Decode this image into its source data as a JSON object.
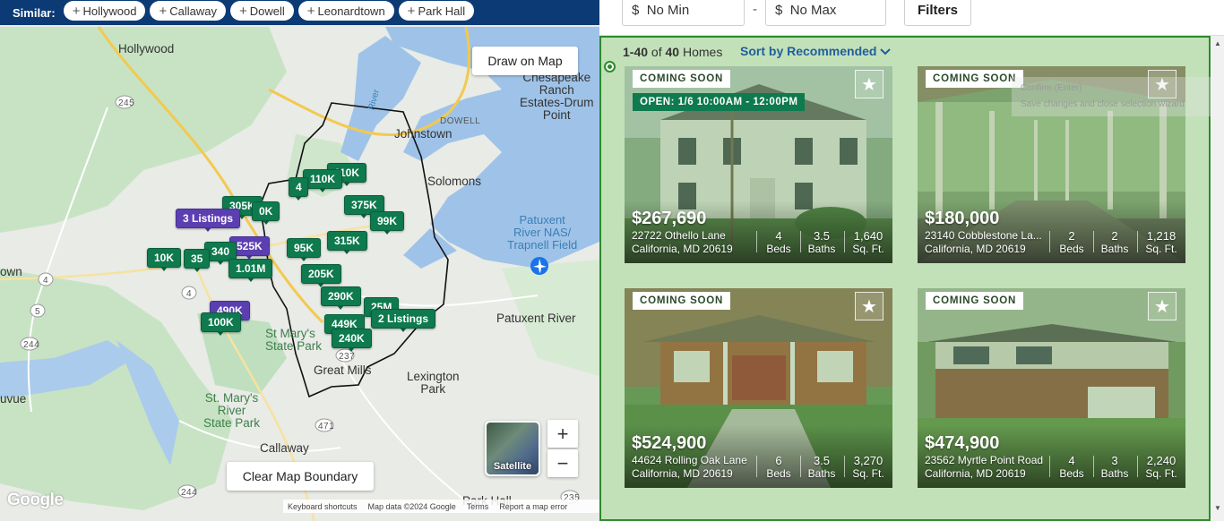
{
  "similar": {
    "label": "Similar:",
    "chips": [
      "Hollywood",
      "Callaway",
      "Dowell",
      "Leonardtown",
      "Park Hall"
    ]
  },
  "map": {
    "places": {
      "hollywood": "Hollywood",
      "chesapeake": "Chesapeake",
      "chesapeake2": "Ranch",
      "chesapeake3": "Estates-Drum",
      "chesapeake4": "Point",
      "dowell": "DOWELL",
      "johnstown": "Johnstown",
      "solomons": "Solomons",
      "patuxent1": "Patuxent",
      "patuxent2": "River NAS/",
      "patuxent3": "Trapnell Field",
      "patuxent_river": "Patuxent River",
      "stmarys_sp1": "St Mary's",
      "stmarys_sp2": "State Park",
      "great_mills": "Great Mills",
      "lexington1": "Lexington",
      "lexington2": "Park",
      "stmarys_river1": "St. Mary's",
      "stmarys_river2": "River",
      "stmarys_river3": "State Park",
      "callaway": "Callaway",
      "town": "own",
      "vue": "uvue",
      "park_hall": "Park Hall",
      "river": "River"
    },
    "routes": [
      "245",
      "4",
      "5",
      "4",
      "244",
      "237",
      "471",
      "244",
      "235"
    ],
    "pins": [
      {
        "label": "110K",
        "type": "g"
      },
      {
        "label": "110K",
        "type": "g"
      },
      {
        "label": "4",
        "type": "g"
      },
      {
        "label": "305K",
        "type": "g"
      },
      {
        "label": "0K",
        "type": "g"
      },
      {
        "label": "3 Listings",
        "type": "p"
      },
      {
        "label": "375K",
        "type": "g"
      },
      {
        "label": "99K",
        "type": "g"
      },
      {
        "label": "525K",
        "type": "p"
      },
      {
        "label": "95K",
        "type": "g"
      },
      {
        "label": "315K",
        "type": "g"
      },
      {
        "label": "340",
        "type": "g"
      },
      {
        "label": "10K",
        "type": "g"
      },
      {
        "label": "35",
        "type": "g"
      },
      {
        "label": "1.01M",
        "type": "g"
      },
      {
        "label": "205K",
        "type": "g"
      },
      {
        "label": "290K",
        "type": "g"
      },
      {
        "label": "490K",
        "type": "p"
      },
      {
        "label": "100K",
        "type": "g"
      },
      {
        "label": "25M",
        "type": "g"
      },
      {
        "label": "2 Listings",
        "type": "g"
      },
      {
        "label": "449K",
        "type": "g"
      },
      {
        "label": "240K",
        "type": "g"
      }
    ],
    "draw_button": "Draw on Map",
    "clear_button": "Clear Map Boundary",
    "zoom_in": "+",
    "zoom_out": "−",
    "satellite": "Satellite",
    "google": "Google",
    "attribution": {
      "shortcuts": "Keyboard shortcuts",
      "data": "Map data ©2024 Google",
      "terms": "Terms",
      "report": "Report a map error"
    }
  },
  "filters": {
    "min_prefix": "$",
    "min": "No Min",
    "dash": "-",
    "max_prefix": "$",
    "max": "No Max",
    "button": "Filters"
  },
  "results": {
    "range": "1-40",
    "of": "of",
    "total": "40",
    "unit": "Homes",
    "sort": "Sort by Recommended"
  },
  "ghost": {
    "line1": "Confirm (Enter)",
    "line2": "Save changes and close selection wizard"
  },
  "listings": [
    {
      "badge": "COMING SOON",
      "open_house": "OPEN: 1/6 10:00AM - 12:00PM",
      "price": "$267,690",
      "street": "22722 Othello Lane",
      "city": "California, MD 20619",
      "beds": "4",
      "beds_label": "Beds",
      "baths": "3.5",
      "baths_label": "Baths",
      "sqft": "1,640",
      "sqft_label": "Sq. Ft."
    },
    {
      "badge": "COMING SOON",
      "price": "$180,000",
      "street": "23140 Cobblestone La...",
      "city": "California, MD 20619",
      "beds": "2",
      "beds_label": "Beds",
      "baths": "2",
      "baths_label": "Baths",
      "sqft": "1,218",
      "sqft_label": "Sq. Ft."
    },
    {
      "badge": "COMING SOON",
      "price": "$524,900",
      "street": "44624 Rolling Oak Lane",
      "city": "California, MD 20619",
      "beds": "6",
      "beds_label": "Beds",
      "baths": "3.5",
      "baths_label": "Baths",
      "sqft": "3,270",
      "sqft_label": "Sq. Ft."
    },
    {
      "badge": "COMING SOON",
      "price": "$474,900",
      "street": "23562 Myrtle Point Road",
      "city": "California, MD 20619",
      "beds": "4",
      "beds_label": "Beds",
      "baths": "3",
      "baths_label": "Baths",
      "sqft": "2,240",
      "sqft_label": "Sq. Ft."
    }
  ],
  "colors": {
    "nav": "#0b3a75",
    "pin_green": "#0e7a4e",
    "pin_purple": "#5b3fb0",
    "highlight_panel": "#c2e1b9",
    "highlight_border": "#2d8a2b",
    "link": "#1e5f9c"
  }
}
